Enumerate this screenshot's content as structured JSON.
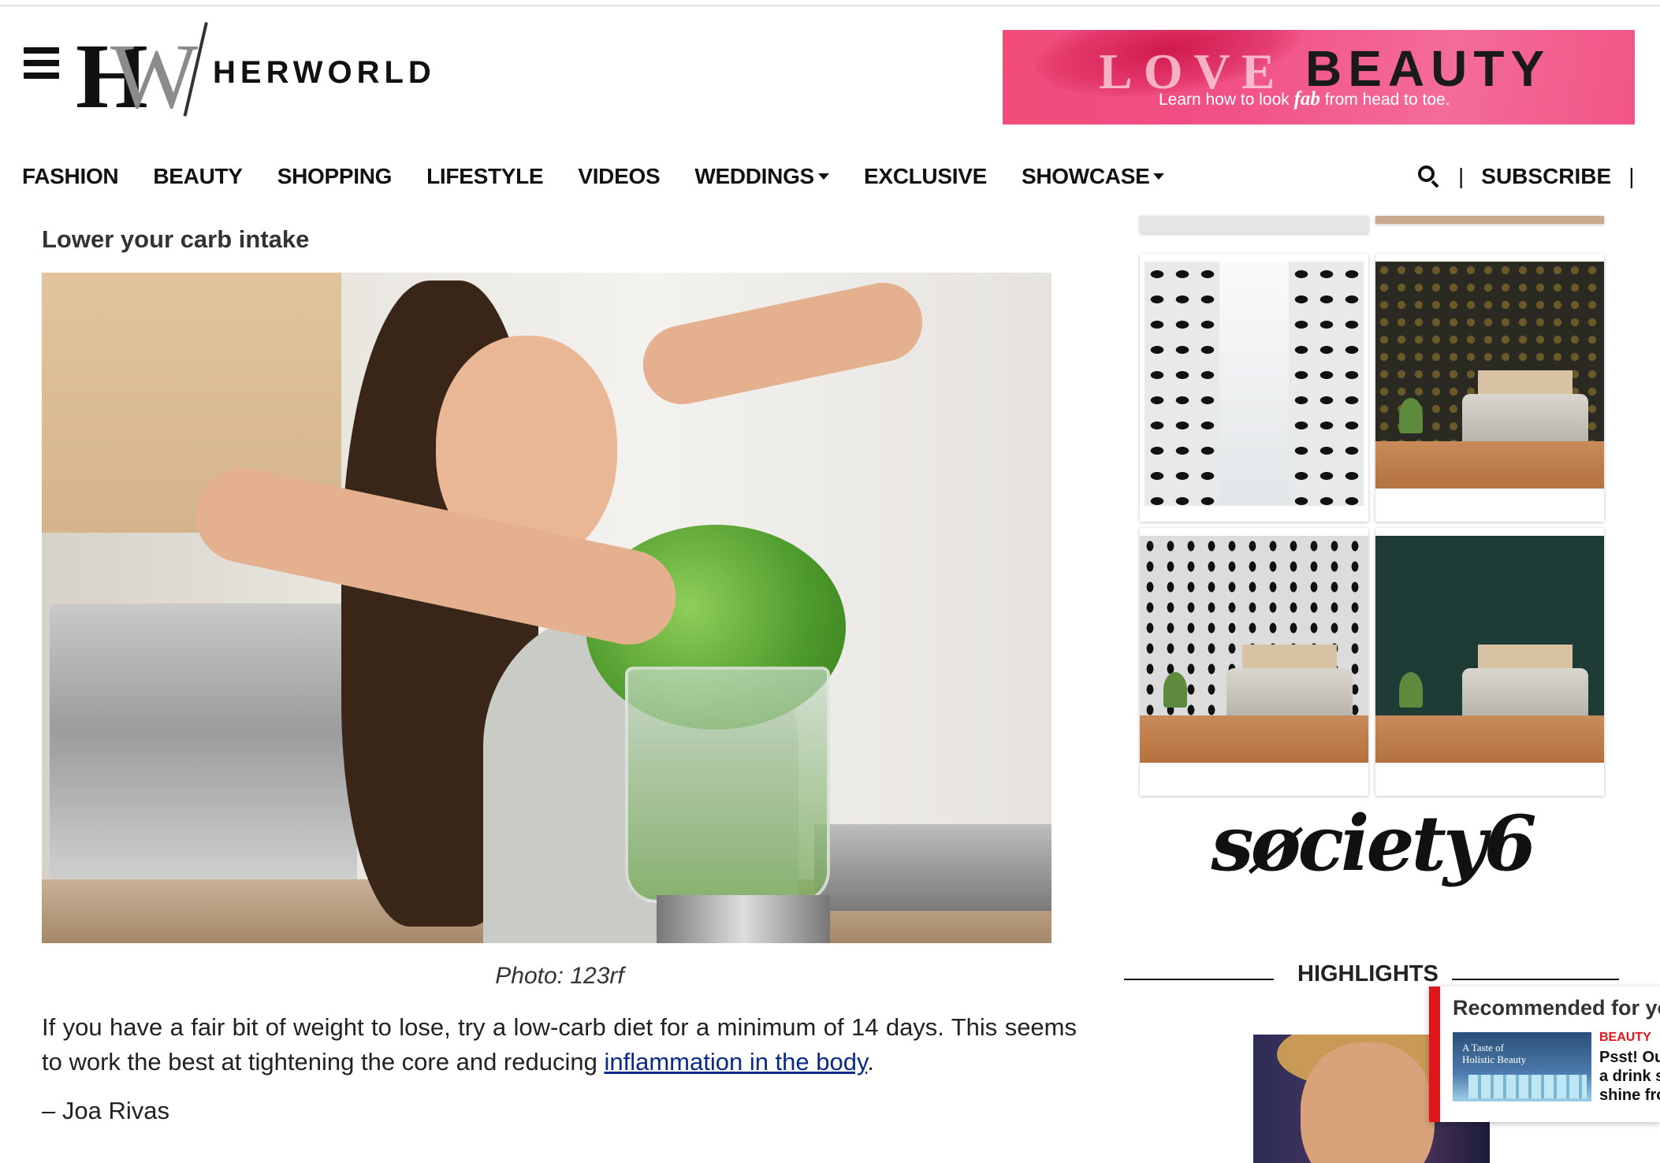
{
  "header": {
    "logo_text": "HERWORLD",
    "logo_letters": "HW",
    "ad": {
      "love": "LOVE",
      "beauty": "BEAUTY",
      "tagline_pre": "Learn how to look ",
      "tagline_em": "fab",
      "tagline_post": " from head to toe."
    }
  },
  "nav": {
    "items": [
      "FASHION",
      "BEAUTY",
      "SHOPPING",
      "LIFESTYLE",
      "VIDEOS",
      "WEDDINGS",
      "EXCLUSIVE",
      "SHOWCASE"
    ],
    "separator": "|",
    "subscribe": "SUBSCRIBE"
  },
  "article": {
    "section_title": "Lower your carb intake",
    "caption": "Photo: 123rf",
    "body_pre": "If you have a fair bit of weight to lose, try a low-carb diet for a minimum of 14 days. This seems to work the best at tightening the core and reducing ",
    "body_link": "inflammation in the body",
    "body_post": ".",
    "author": "– Joa Rivas"
  },
  "sidebar": {
    "ad_brand": "søciety6",
    "highlights_title": "HIGHLIGHTS"
  },
  "recommended": {
    "title": "Recommended for yo",
    "thumb_text": "A Taste of\nHolistic Beauty",
    "category": "BEAUTY",
    "headline": "Psst! Ou\na drink s\nshine fro"
  }
}
